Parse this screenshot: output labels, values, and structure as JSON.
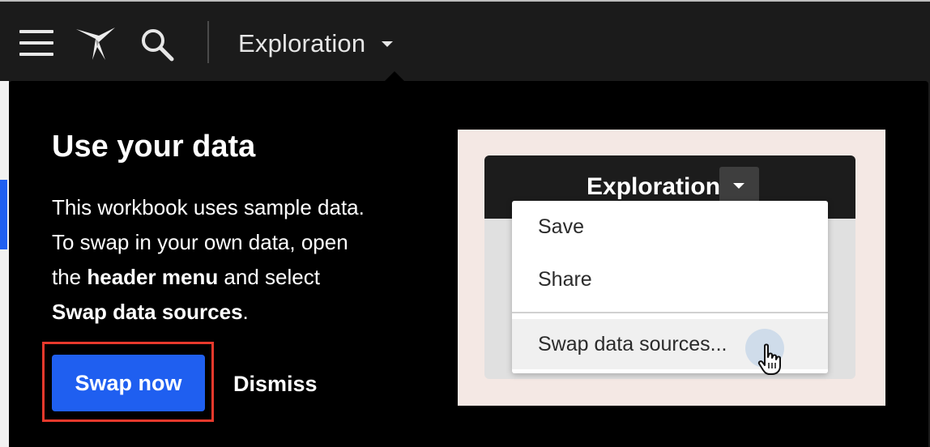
{
  "header": {
    "title": "Exploration",
    "menu_icon": "hamburger-menu-icon",
    "logo_icon": "bird-logo-icon",
    "search_icon": "search-icon",
    "dropdown_icon": "caret-down-icon"
  },
  "dialog": {
    "heading": "Use your data",
    "body_line1": "This workbook uses sample data.",
    "body_line2": "To swap in your own data, open",
    "body_line3_pre": "the ",
    "body_line3_bold": "header menu",
    "body_line3_post": " and select",
    "body_line4_bold": "Swap data sources",
    "body_line4_post": ".",
    "primary_button": "Swap now",
    "secondary_button": "Dismiss"
  },
  "illustration": {
    "title": "Exploration",
    "menu_items": [
      "Save",
      "Share",
      "Swap data sources..."
    ],
    "cursor_icon": "hand-pointer-icon"
  },
  "colors": {
    "accent": "#1f5ff0",
    "highlight_border": "#e8392c",
    "illustration_bg": "#f4e8e4"
  }
}
